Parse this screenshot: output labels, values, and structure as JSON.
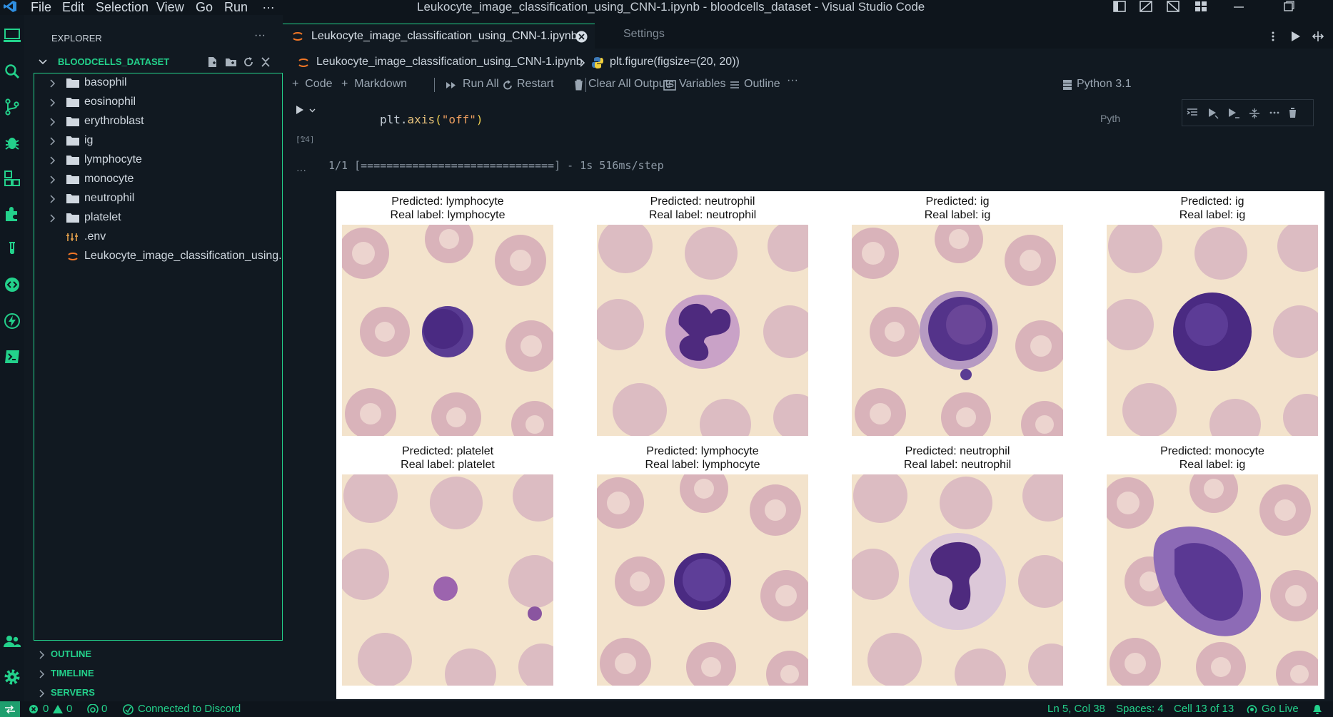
{
  "window": {
    "title": "Leukocyte_image_classification_using_CNN-1.ipynb - bloodcells_dataset - Visual Studio Code",
    "menu": [
      "File",
      "Edit",
      "Selection",
      "View",
      "Go",
      "Run",
      "…"
    ]
  },
  "sidebar": {
    "title": "EXPLORER",
    "more": "···",
    "workspace": "BLOODCELLS_DATASET",
    "items": [
      {
        "label": "basophil",
        "type": "folder"
      },
      {
        "label": "eosinophil",
        "type": "folder"
      },
      {
        "label": "erythroblast",
        "type": "folder"
      },
      {
        "label": "ig",
        "type": "folder"
      },
      {
        "label": "lymphocyte",
        "type": "folder"
      },
      {
        "label": "monocyte",
        "type": "folder"
      },
      {
        "label": "neutrophil",
        "type": "folder"
      },
      {
        "label": "platelet",
        "type": "folder"
      },
      {
        "label": ".env",
        "type": "file"
      },
      {
        "label": "Leukocyte_image_classification_using...",
        "type": "notebook"
      }
    ],
    "sections": [
      "OUTLINE",
      "TIMELINE",
      "SERVERS"
    ]
  },
  "tabs": {
    "active": "Leukocyte_image_classification_using_CNN-1.ipynb",
    "settings": "Settings"
  },
  "breadcrumb": {
    "file": "Leukocyte_image_classification_using_CNN-1.ipynb",
    "symbol": "plt.figure(figsize=(20, 20))"
  },
  "toolbar": {
    "code": "Code",
    "markdown": "Markdown",
    "run_all": "Run All",
    "restart": "Restart",
    "clear": "Clear All Outputs",
    "variables": "Variables",
    "outline": "Outline",
    "more": "···",
    "kernel": "Python 3.1"
  },
  "cell": {
    "code_obj": "plt",
    "code_fn": "axis",
    "code_arg": "\"off\"",
    "exec_count": "[14]",
    "output": "1/1 [==============================] - 1s 516ms/step",
    "lang": "Pyth"
  },
  "figure": {
    "panels": [
      {
        "predicted": "Predicted: lymphocyte",
        "real": "Real label: lymphocyte",
        "cell_type": "lymphocyte"
      },
      {
        "predicted": "Predicted: neutrophil",
        "real": "Real label: neutrophil",
        "cell_type": "neutrophil"
      },
      {
        "predicted": "Predicted: ig",
        "real": "Real label: ig",
        "cell_type": "ig"
      },
      {
        "predicted": "Predicted: ig",
        "real": "Real label: ig",
        "cell_type": "ig"
      },
      {
        "predicted": "Predicted: platelet",
        "real": "Real label: platelet",
        "cell_type": "platelet"
      },
      {
        "predicted": "Predicted: lymphocyte",
        "real": "Real label: lymphocyte",
        "cell_type": "lymphocyte"
      },
      {
        "predicted": "Predicted: neutrophil",
        "real": "Real label: neutrophil",
        "cell_type": "neutrophil"
      },
      {
        "predicted": "Predicted: monocyte",
        "real": "Real label: ig",
        "cell_type": "monocyte"
      }
    ]
  },
  "statusbar": {
    "errors": "0",
    "warnings": "0",
    "ports": "0",
    "discord": "Connected to Discord",
    "position": "Ln 5, Col 38",
    "spaces": "Spaces: 4",
    "cell": "Cell 13 of 13",
    "go_live": "Go Live"
  },
  "colors": {
    "accent": "#23d18b",
    "background": "#111921",
    "cell_nucleus": "#4a2a8a",
    "rbc": "#d8b0b8",
    "slide_bg": "#f3e3cc"
  }
}
